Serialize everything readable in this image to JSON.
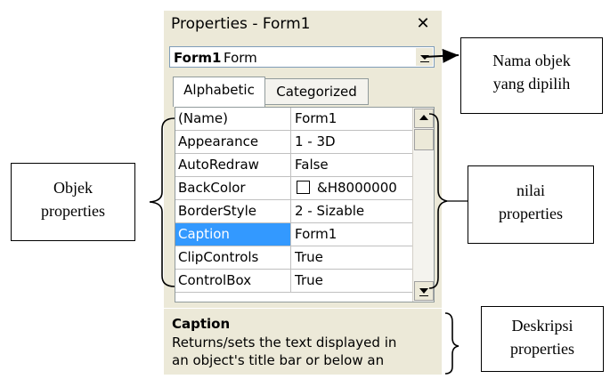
{
  "window": {
    "title": "Properties - Form1",
    "close_glyph": "✕",
    "object_selector": {
      "name": "Form1",
      "type": "Form"
    },
    "tabs": [
      {
        "label": "Alphabetic",
        "active": true
      },
      {
        "label": "Categorized",
        "active": false
      }
    ],
    "properties": [
      {
        "name": "(Name)",
        "value": "Form1"
      },
      {
        "name": "Appearance",
        "value": "1 - 3D"
      },
      {
        "name": "AutoRedraw",
        "value": "False"
      },
      {
        "name": "BackColor",
        "value": "&H8000000"
      },
      {
        "name": "BorderStyle",
        "value": "2 - Sizable"
      },
      {
        "name": "Caption",
        "value": "Form1",
        "selected": true
      },
      {
        "name": "ClipControls",
        "value": "True"
      },
      {
        "name": "ControlBox",
        "value": "True"
      }
    ],
    "description": {
      "title": "Caption",
      "line1": "Returns/sets the text displayed in",
      "line2": "an object's title bar or below an"
    }
  },
  "annotations": {
    "nama_objek": {
      "line1": "Nama objek",
      "line2": "yang dipilih"
    },
    "objek_properties": {
      "line1": "Objek",
      "line2": "properties"
    },
    "nilai_properties": {
      "line1": "nilai",
      "line2": "properties"
    },
    "deskripsi_properties": {
      "line1": "Deskripsi",
      "line2": "properties"
    }
  },
  "colors": {
    "selection": "#3399ff",
    "window_bg": "#ece9d8"
  },
  "icons": [
    "close-icon",
    "dropdown-arrow-icon",
    "scroll-up-icon",
    "scroll-down-icon",
    "color-swatch-icon"
  ]
}
